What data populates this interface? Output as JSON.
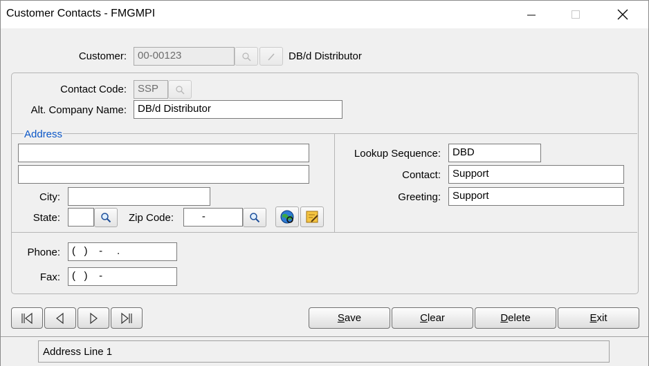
{
  "window": {
    "title": "Customer Contacts - FMGMPI"
  },
  "customer": {
    "label": "Customer:",
    "value": "00-00123",
    "name": "DB/d Distributor"
  },
  "contact": {
    "code_label": "Contact Code:",
    "code_value": "SSP",
    "alt_company_label": "Alt. Company Name:",
    "alt_company_value": "DB/d Distributor"
  },
  "address": {
    "legend": "Address",
    "line1": "",
    "line2": "",
    "city_label": "City:",
    "city_value": "",
    "state_label": "State:",
    "state_value": "",
    "zip_label": "Zip Code:",
    "zip_value": "     -"
  },
  "right": {
    "lookup_label": "Lookup Sequence:",
    "lookup_value": "DBD",
    "contact_label": "Contact:",
    "contact_value": "Support",
    "greeting_label": "Greeting:",
    "greeting_value": "Support"
  },
  "phones": {
    "phone_label": "Phone:",
    "phone_value": "(   )    -     .",
    "fax_label": "Fax:",
    "fax_value": "(   )    -"
  },
  "buttons": {
    "save": {
      "key": "S",
      "rest": "ave"
    },
    "clear": {
      "key": "C",
      "rest": "lear"
    },
    "delete": {
      "key": "D",
      "rest": "elete"
    },
    "exit": {
      "key": "E",
      "rest": "xit"
    }
  },
  "status": {
    "text": "Address Line 1"
  },
  "colors": {
    "legend": "#0a56c7",
    "background": "#f0f0f0"
  }
}
